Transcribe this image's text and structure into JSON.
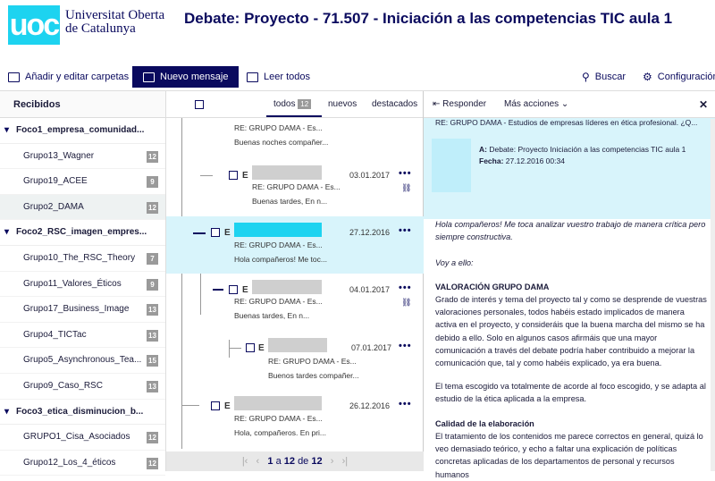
{
  "header": {
    "logo": "uoc",
    "university": [
      "Universitat Oberta",
      "de Catalunya"
    ],
    "title": "Debate: Proyecto - 71.507 - Iniciación a las competencias TIC aula 1"
  },
  "toolbar": {
    "add_folders": "Añadir y editar carpetas",
    "new_message": "Nuevo mensaje",
    "read_all": "Leer todos",
    "search": "Buscar",
    "settings": "Configuración"
  },
  "sidebar": {
    "header": "Recibidos",
    "groups": [
      {
        "label": "Foco1_empresa_comunidad...",
        "items": [
          {
            "label": "Grupo13_Wagner",
            "count": "12"
          },
          {
            "label": "Grupo19_ACEE",
            "count": "9"
          },
          {
            "label": "Grupo2_DAMA",
            "count": "12"
          }
        ]
      },
      {
        "label": "Foco2_RSC_imagen_empres...",
        "items": [
          {
            "label": "Grupo10_The_RSC_Theory",
            "count": "7"
          },
          {
            "label": "Grupo11_Valores_Éticos",
            "count": "9"
          },
          {
            "label": "Grupo17_Business_Image",
            "count": "13"
          },
          {
            "label": "Grupo4_TICTac",
            "count": "13"
          },
          {
            "label": "Grupo5_Asynchronous_Tea...",
            "count": "15"
          },
          {
            "label": "Grupo9_Caso_RSC",
            "count": "13"
          }
        ]
      },
      {
        "label": "Foco3_etica_disminucion_b...",
        "items": [
          {
            "label": "GRUPO1_Cisa_Asociados",
            "count": "12"
          },
          {
            "label": "Grupo12_Los_4_éticos",
            "count": "12"
          }
        ]
      }
    ]
  },
  "list": {
    "filters": {
      "all": "todos",
      "all_count": "12",
      "new": "nuevos",
      "featured": "destacados"
    },
    "messages": [
      {
        "subject": "RE: GRUPO DAMA - Es...",
        "preview": "Buenas noches compañer...",
        "date": "",
        "tag": ""
      },
      {
        "subject": "RE: GRUPO DAMA - Es...",
        "preview": "Buenas tardes, En n...",
        "date": "03.01.2017",
        "tag": "E"
      },
      {
        "subject": "RE: GRUPO DAMA - Es...",
        "preview": "Hola compañeros! Me toc...",
        "date": "27.12.2016",
        "tag": "E"
      },
      {
        "subject": "RE: GRUPO DAMA - Es...",
        "preview": "Buenas tardes, En n...",
        "date": "04.01.2017",
        "tag": "E"
      },
      {
        "subject": "RE: GRUPO DAMA - Es...",
        "preview": "Buenos tardes compañer...",
        "date": "07.01.2017",
        "tag": "E"
      },
      {
        "subject": "RE: GRUPO DAMA - Es...",
        "preview": "Hola, compañeros. En pri...",
        "date": "26.12.2016",
        "tag": "E"
      }
    ],
    "pagination": {
      "current": "1",
      "of": "a",
      "total": "12",
      "of2": "de",
      "total2": "12"
    }
  },
  "reader": {
    "reply": "Responder",
    "more": "Más acciones",
    "subject_line": "RE: GRUPO DAMA - Estudios de empresas líderes en ética profesional. ¿Q...",
    "to_label": "A:",
    "to_value": "Debate: Proyecto Iniciación a las competencias TIC aula 1",
    "date_label": "Fecha:",
    "date_value": "27.12.2016 00:34",
    "body": [
      "Hola compañeros! Me toca analizar vuestro trabajo de manera crítica pero siempre constructiva.",
      "Voy a ello:",
      "VALORACIÓN GRUPO DAMA",
      "Grado de interés y tema del proyecto tal y como se desprende de vuestras valoraciones personales, todos habéis estado implicados de manera activa en el proyecto, y consideráis que la buena marcha del mismo se ha debido a ello. Solo en algunos casos afirmáis que una mayor comunicación a través del debate podría haber contribuido a mejorar la comunicación que, tal y como habéis explicado, ya era buena.",
      "El tema escogido va totalmente de acorde al foco escogido, y se adapta al estudio de la ética aplicada a la empresa.",
      "Calidad de la elaboración",
      "El tratamiento de los contenidos me parece correctos en general, quizá lo veo demasiado teórico, y echo a faltar una explicación de políticas concretas aplicadas de los departamentos de personal y recursos humanos"
    ]
  },
  "colors": {
    "brand": "#1dd3f0",
    "navy": "#0a0a5e",
    "selected": "#d8f4fb"
  }
}
